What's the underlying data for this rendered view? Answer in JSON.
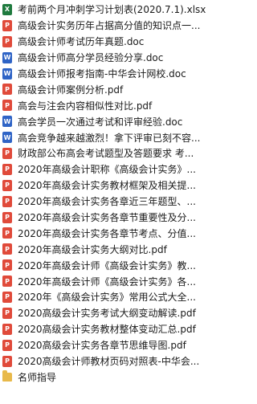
{
  "files": [
    {
      "icon": "xlsx-file-icon",
      "type": "xls",
      "badge": "X",
      "name": "考前两个月冲刺学习计划表(2020.7.1).xlsx"
    },
    {
      "icon": "pdf-file-icon",
      "type": "pdf",
      "badge": "P",
      "name": "高级会计实务历年占据高分值的知识点一..."
    },
    {
      "icon": "pdf-file-icon",
      "type": "pdf",
      "badge": "P",
      "name": "高级会计师考试历年真题.doc"
    },
    {
      "icon": "doc-file-icon",
      "type": "doc",
      "badge": "W",
      "name": "高级会计师高分学员经验分享.doc"
    },
    {
      "icon": "doc-file-icon",
      "type": "doc",
      "badge": "W",
      "name": "高级会计师报考指南-中华会计网校.doc"
    },
    {
      "icon": "pdf-file-icon",
      "type": "pdf",
      "badge": "P",
      "name": "高级会计师案例分析.pdf"
    },
    {
      "icon": "pdf-file-icon",
      "type": "pdf",
      "badge": "P",
      "name": "高会与注会内容相似性对比.pdf"
    },
    {
      "icon": "doc-file-icon",
      "type": "doc",
      "badge": "W",
      "name": "高会学员一次通过考试和评审经验.doc"
    },
    {
      "icon": "doc-file-icon",
      "type": "doc",
      "badge": "W",
      "name": "高会竞争越来越激烈！拿下评审已刻不容..."
    },
    {
      "icon": "pdf-file-icon",
      "type": "pdf",
      "badge": "P",
      "name": "财政部公布高会考试题型及答题要求 考..."
    },
    {
      "icon": "pdf-file-icon",
      "type": "pdf",
      "badge": "P",
      "name": "2020年高级会计职称《高级会计实务》..."
    },
    {
      "icon": "pdf-file-icon",
      "type": "pdf",
      "badge": "P",
      "name": "2020年高级会计实务教材框架及相关提..."
    },
    {
      "icon": "pdf-file-icon",
      "type": "pdf",
      "badge": "P",
      "name": "2020年高级会计实务各章近三年题型、..."
    },
    {
      "icon": "pdf-file-icon",
      "type": "pdf",
      "badge": "P",
      "name": "2020年高级会计实务各章节重要性及分..."
    },
    {
      "icon": "pdf-file-icon",
      "type": "pdf",
      "badge": "P",
      "name": "2020年高级会计实务各章节考点、分值..."
    },
    {
      "icon": "pdf-file-icon",
      "type": "pdf",
      "badge": "P",
      "name": "2020年高级会计实务大纲对比.pdf"
    },
    {
      "icon": "pdf-file-icon",
      "type": "pdf",
      "badge": "P",
      "name": "2020年高级会计师《高级会计实务》教..."
    },
    {
      "icon": "pdf-file-icon",
      "type": "pdf",
      "badge": "P",
      "name": "2020年高级会计师《高级会计实务》各..."
    },
    {
      "icon": "pdf-file-icon",
      "type": "pdf",
      "badge": "P",
      "name": "2020年《高级会计实务》常用公式大全..."
    },
    {
      "icon": "pdf-file-icon",
      "type": "pdf",
      "badge": "P",
      "name": "2020高级会计实务考试大纲变动解读.pdf"
    },
    {
      "icon": "pdf-file-icon",
      "type": "pdf",
      "badge": "P",
      "name": "2020高级会计实务教材整体变动汇总.pdf"
    },
    {
      "icon": "pdf-file-icon",
      "type": "pdf",
      "badge": "P",
      "name": "2020高级会计实务各章节思维导图.pdf"
    },
    {
      "icon": "pdf-file-icon",
      "type": "pdf",
      "badge": "P",
      "name": "2020高级会计师教材页码对照表-中华会..."
    },
    {
      "icon": "folder-icon",
      "type": "folder",
      "badge": "",
      "name": "名师指导"
    }
  ]
}
